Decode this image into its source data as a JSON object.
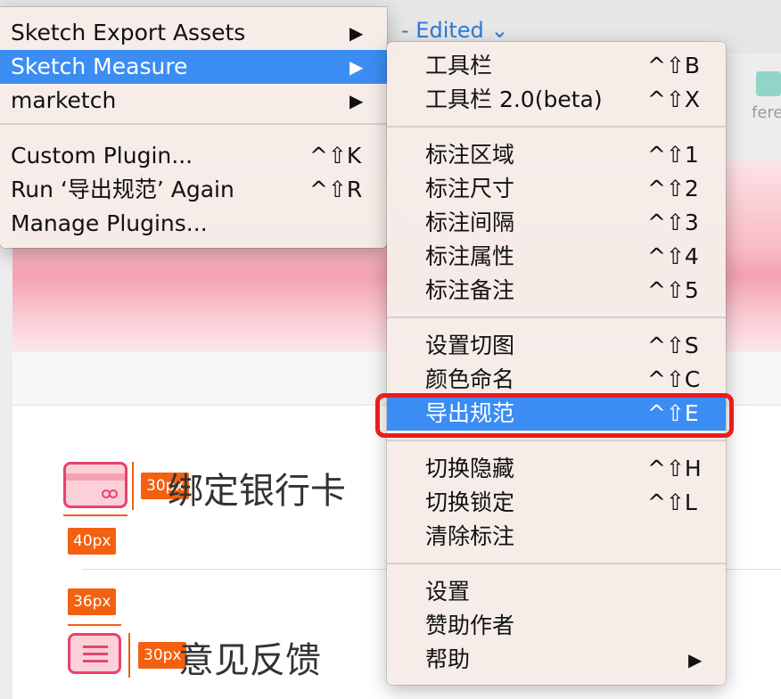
{
  "window": {
    "title_suffix": "- Edited ⌄"
  },
  "toolbar": {
    "partial_label": "fere"
  },
  "plugins_menu": {
    "items": [
      {
        "label": "Sketch Export Assets",
        "submenu": "▶"
      },
      {
        "label": "Sketch Measure",
        "submenu": "▶"
      },
      {
        "label": "marketch",
        "submenu": "▶"
      },
      {
        "label": "Custom Plugin...",
        "shortcut": "^⇧K"
      },
      {
        "label": "Run ‘导出规范’ Again",
        "shortcut": "^⇧R"
      },
      {
        "label": "Manage Plugins..."
      }
    ]
  },
  "measure_menu": {
    "items": [
      {
        "label": "工具栏",
        "shortcut": "^⇧B"
      },
      {
        "label": "工具栏 2.0(beta)",
        "shortcut": "^⇧X"
      },
      {
        "label": "标注区域",
        "shortcut": "^⇧1"
      },
      {
        "label": "标注尺寸",
        "shortcut": "^⇧2"
      },
      {
        "label": "标注间隔",
        "shortcut": "^⇧3"
      },
      {
        "label": "标注属性",
        "shortcut": "^⇧4"
      },
      {
        "label": "标注备注",
        "shortcut": "^⇧5"
      },
      {
        "label": "设置切图",
        "shortcut": "^⇧S"
      },
      {
        "label": "颜色命名",
        "shortcut": "^⇧C"
      },
      {
        "label": "导出规范",
        "shortcut": "^⇧E"
      },
      {
        "label": "切换隐藏",
        "shortcut": "^⇧H"
      },
      {
        "label": "切换锁定",
        "shortcut": "^⇧L"
      },
      {
        "label": "清除标注"
      },
      {
        "label": "设置"
      },
      {
        "label": "赞助作者"
      },
      {
        "label": "帮助",
        "submenu": "▶"
      }
    ]
  },
  "artboard": {
    "rows": [
      {
        "title": "绑定银行卡",
        "width_tag": "40px",
        "height_tag": "30px"
      },
      {
        "title": "意见反馈",
        "width_tag": "36px",
        "height_tag": "30px"
      }
    ]
  },
  "colors": {
    "accent": "#3b8df3",
    "measure": "#f36010",
    "highlight": "#ee1b1b",
    "icon": "#e8436a"
  }
}
